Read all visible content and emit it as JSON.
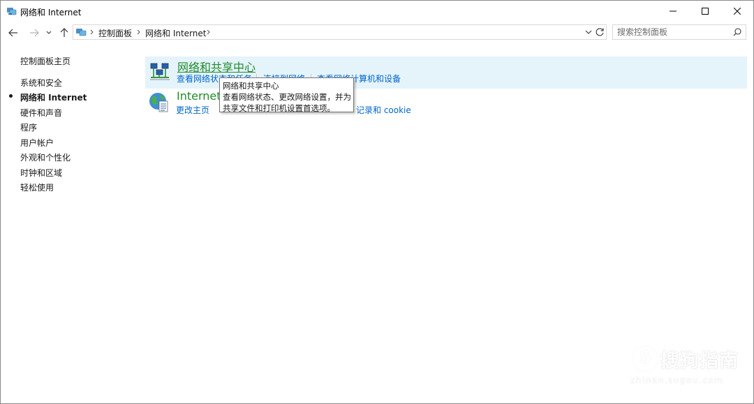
{
  "window": {
    "title": "网络和 Internet"
  },
  "address_bar": {
    "crumbs": [
      "控制面板",
      "网络和 Internet"
    ]
  },
  "search": {
    "placeholder": "搜索控制面板"
  },
  "sidebar": {
    "home": "控制面板主页",
    "items": [
      {
        "label": "系统和安全",
        "active": false
      },
      {
        "label": "网络和 Internet",
        "active": true
      },
      {
        "label": "硬件和声音",
        "active": false
      },
      {
        "label": "程序",
        "active": false
      },
      {
        "label": "用户帐户",
        "active": false
      },
      {
        "label": "外观和个性化",
        "active": false
      },
      {
        "label": "时钟和区域",
        "active": false
      },
      {
        "label": "轻松使用",
        "active": false
      }
    ]
  },
  "categories": [
    {
      "title": "网络和共享中心",
      "icon": "network-sharing-center-icon",
      "tasks": [
        "查看网络状态和任务",
        "连接到网络",
        "查看网络计算机和设备"
      ]
    },
    {
      "title": "Internet",
      "icon": "internet-options-globe-icon",
      "tasks": [
        "更改主页",
        "记录和 cookie"
      ]
    }
  ],
  "tooltip": {
    "lines": [
      "网络和共享中心",
      "查看网络状态、更改网络设置，并为",
      "共享文件和打印机设置首选项。"
    ]
  },
  "watermark": {
    "text": "搜狗指南",
    "url": "zhinan.sogou.com"
  },
  "colors": {
    "category_title": "#1e8c2a",
    "task_link": "#0066cc",
    "hover_bg": "#e5f3fb"
  }
}
